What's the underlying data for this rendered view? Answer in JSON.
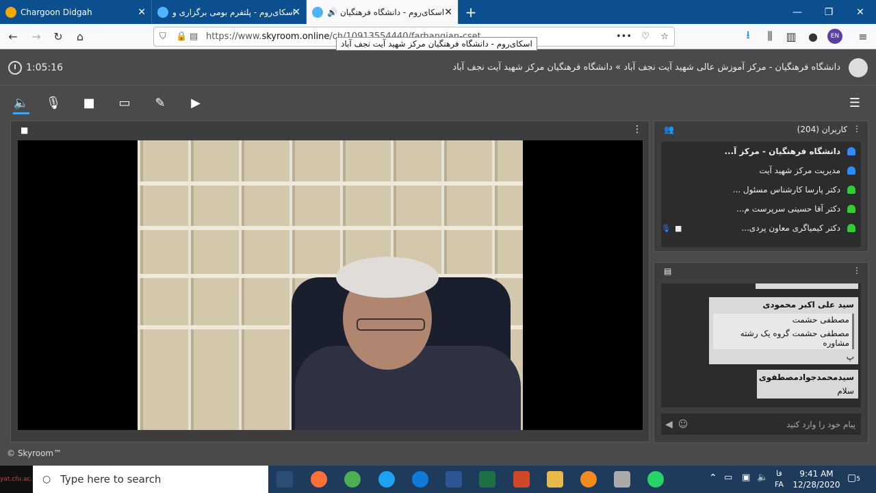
{
  "browser": {
    "tabs": [
      {
        "title": "Chargoon Didgah",
        "active": false
      },
      {
        "title": "اسکای‌روم - پلتفرم بومی برگزاری و",
        "active": false
      },
      {
        "title": "اسکای‌روم - دانشگاه فرهنگیان",
        "active": true
      }
    ],
    "new_tab": "+",
    "url_prefix": "https://www.",
    "url_domain": "skyroom.online",
    "url_rest": "/ch/10913554440/farhangian-cset",
    "tooltip": "اسکای‌روم - دانشگاه فرهنگیان مرکز شهید آیت نجف آباد",
    "profile_badge": "EN"
  },
  "header": {
    "timer": "1:05:16",
    "room_title": "دانشگاه فرهنگیان - مرکز آموزش عالی شهید آیت نجف آباد » دانشگاه فرهنگیان مرکز شهید آیت نجف آباد"
  },
  "users_panel": {
    "title": "کاربران (204)",
    "users": [
      {
        "name": "دانشگاه فرهنگیان - مرکز آ...",
        "color": "#2d8cff",
        "bold": true
      },
      {
        "name": "مدیریت مرکز شهید آیت",
        "color": "#2d8cff",
        "bold": false
      },
      {
        "name": "دکتر پارسا کارشناس مسئول ...",
        "color": "#33cc33",
        "bold": false
      },
      {
        "name": "دکتر آقا حسینی سرپرست م...",
        "color": "#33cc33",
        "bold": false
      },
      {
        "name": "دکتر کیمیاگری معاون پردی...",
        "color": "#33cc33",
        "bold": false
      }
    ]
  },
  "chat_panel": {
    "messages": [
      {
        "name": "سید علی اکبر محمودی",
        "quote1": "مصطفی حشمت",
        "quote2": "مصطفی حشمت گروه یک  رشته مشاوره",
        "text": "پ"
      },
      {
        "name": "سیدمحمدجوادمصطفوی",
        "text": "سلام"
      }
    ],
    "input_placeholder": "پیام خود را وارد کنید"
  },
  "footer": {
    "copyright": "© Skyroom™"
  },
  "taskbar": {
    "search_placeholder": "Type here to search",
    "watermark": "ayat.cfu.ac.ir",
    "time": "9:41 AM",
    "date": "12/28/2020",
    "lang_top": "فا",
    "lang_bottom": "FA",
    "notif_count": "5"
  }
}
